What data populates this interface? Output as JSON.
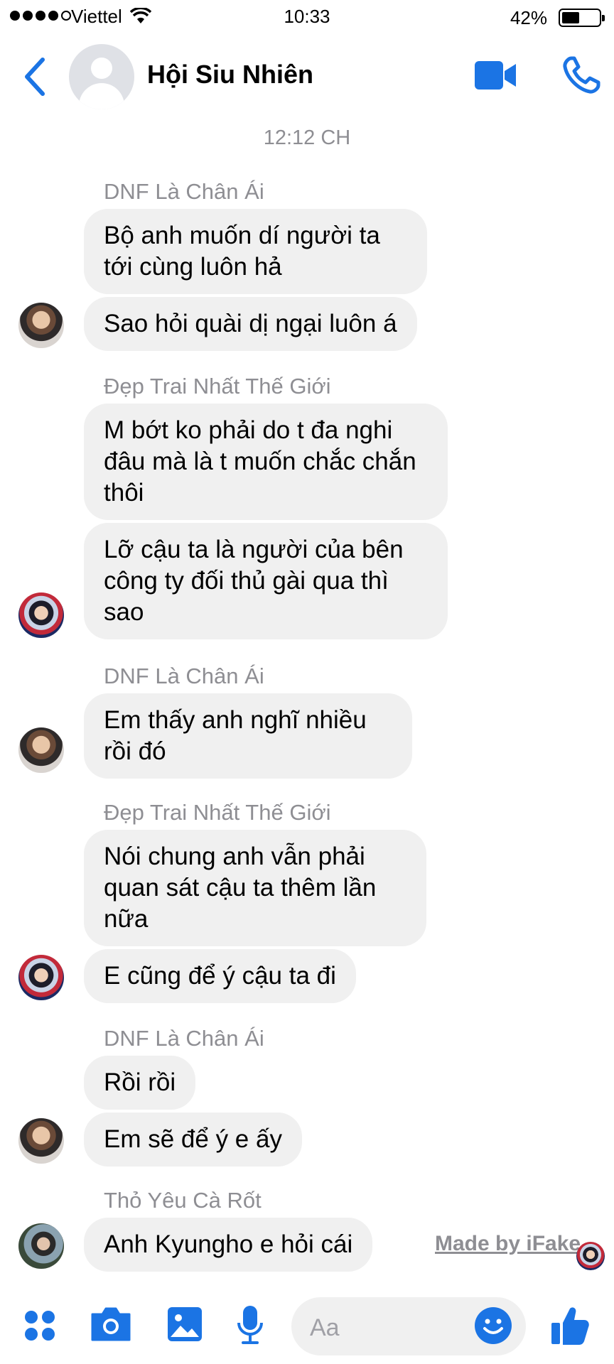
{
  "status_bar": {
    "carrier": "Viettel",
    "time": "10:33",
    "battery": "42%"
  },
  "header": {
    "group_name": "Hội Siu Nhiên"
  },
  "conversation": {
    "timestamp": "12:12 CH",
    "senders": {
      "s1": "DNF Là Chân Ái",
      "s2": "Đẹp Trai Nhất Thế Giới",
      "s3": "DNF Là Chân Ái",
      "s4": "Đẹp Trai Nhất Thế Giới",
      "s5": "DNF Là Chân Ái",
      "s6": "Thỏ Yêu Cà Rốt"
    },
    "messages": {
      "m1": "Bộ anh muốn dí người ta tới cùng luôn hả",
      "m2": "Sao hỏi quài dị ngại luôn á",
      "m3": "M bớt ko phải do t đa nghi đâu mà là t muốn chắc chắn thôi",
      "m4": "Lỡ cậu ta là người của bên công ty đối thủ gài qua thì sao",
      "m5": "Em thấy anh nghĩ nhiều rồi đó",
      "m6": "Nói chung anh vẫn phải quan sát cậu ta thêm lần nữa",
      "m7": "E cũng để ý cậu ta đi",
      "m8": "Rồi rồi",
      "m9": "Em sẽ để ý e ấy",
      "m10": "Anh Kyungho e hỏi cái"
    }
  },
  "watermark": "Made by iFake",
  "composer": {
    "placeholder": "Aa"
  }
}
